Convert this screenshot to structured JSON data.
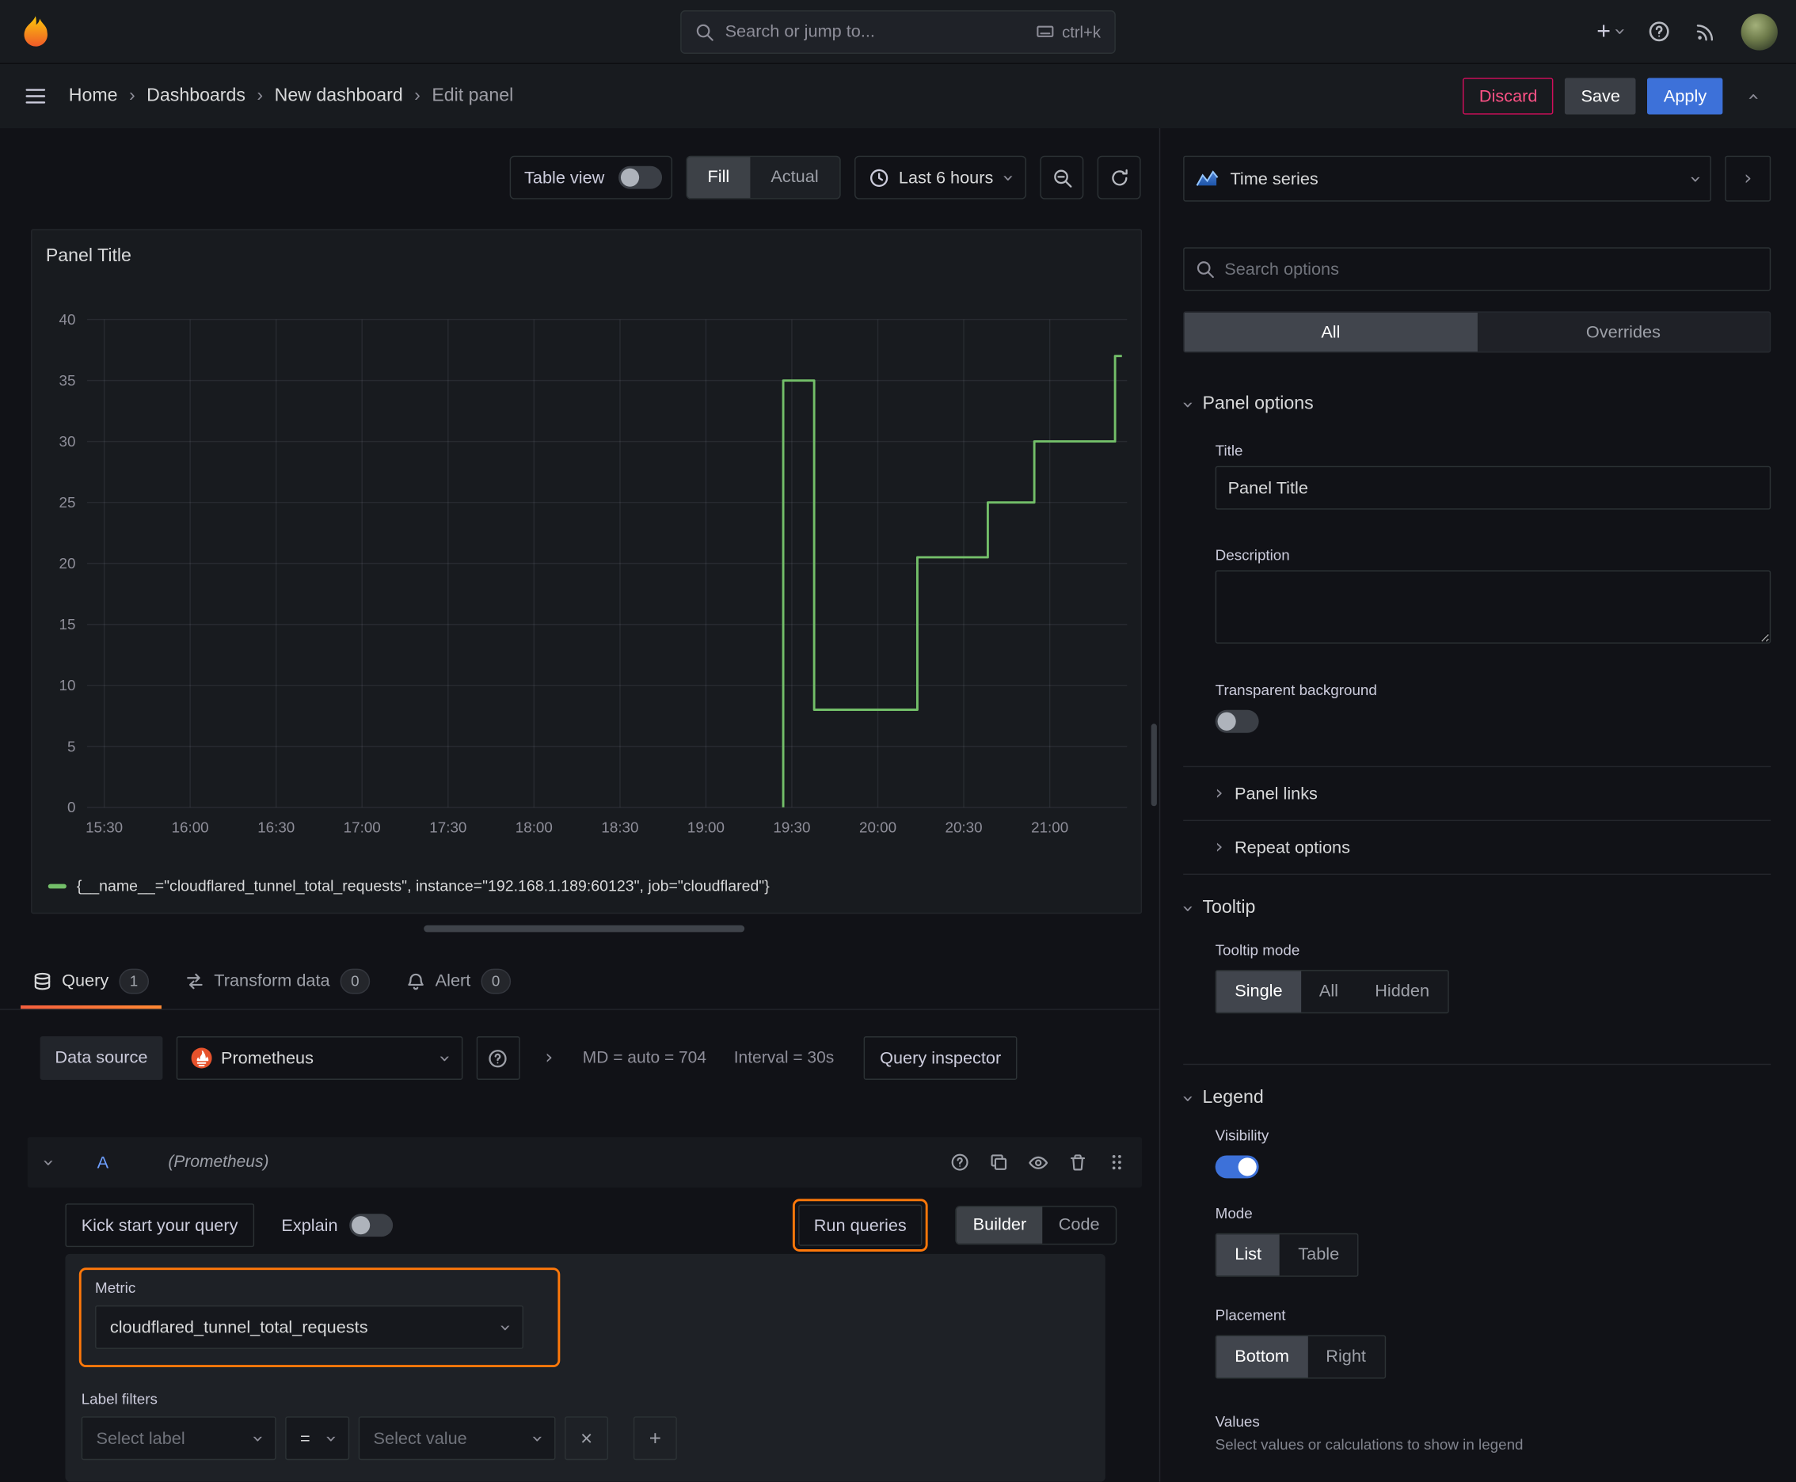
{
  "topnav": {
    "search_placeholder": "Search or jump to...",
    "search_shortcut": "ctrl+k"
  },
  "breadcrumb": {
    "items": [
      "Home",
      "Dashboards",
      "New dashboard",
      "Edit panel"
    ]
  },
  "actions": {
    "discard": "Discard",
    "save": "Save",
    "apply": "Apply"
  },
  "toolbar": {
    "table_view": "Table view",
    "fill": "Fill",
    "actual": "Actual",
    "time_range": "Last 6 hours"
  },
  "panel": {
    "title": "Panel Title"
  },
  "chart_data": {
    "type": "line",
    "title": "Panel Title",
    "x_ticks": [
      "15:30",
      "16:00",
      "16:30",
      "17:00",
      "17:30",
      "18:00",
      "18:30",
      "19:00",
      "19:30",
      "20:00",
      "20:30",
      "21:00"
    ],
    "y_ticks": [
      0,
      5,
      10,
      15,
      20,
      25,
      30,
      35,
      40
    ],
    "ylim": [
      0,
      40
    ],
    "xlim_hours": [
      15.4,
      21.45
    ],
    "grid": true,
    "legend_position": "bottom",
    "series": [
      {
        "name": "{__name__=\"cloudflared_tunnel_total_requests\", instance=\"192.168.1.189:60123\", job=\"cloudflared\"}",
        "color": "#73bf69",
        "points_hours_value": [
          [
            19.45,
            0
          ],
          [
            19.45,
            35
          ],
          [
            19.63,
            35
          ],
          [
            19.63,
            8
          ],
          [
            20.23,
            8
          ],
          [
            20.23,
            20.5
          ],
          [
            20.64,
            20.5
          ],
          [
            20.64,
            25
          ],
          [
            20.91,
            25
          ],
          [
            20.91,
            30
          ],
          [
            21.38,
            30
          ],
          [
            21.38,
            37
          ],
          [
            21.42,
            37
          ]
        ]
      }
    ]
  },
  "tabs": [
    {
      "label": "Query",
      "count": "1"
    },
    {
      "label": "Transform data",
      "count": "0"
    },
    {
      "label": "Alert",
      "count": "0"
    }
  ],
  "query": {
    "datasource_label": "Data source",
    "datasource": "Prometheus",
    "max_data_points": "MD = auto = 704",
    "interval": "Interval = 30s",
    "query_inspector": "Query inspector",
    "ref_id": "A",
    "ref_datasource": "(Prometheus)",
    "kick_start": "Kick start your query",
    "explain": "Explain",
    "run_queries": "Run queries",
    "builder": "Builder",
    "code": "Code",
    "metric_label": "Metric",
    "metric_value": "cloudflared_tunnel_total_requests",
    "label_filters": "Label filters",
    "select_label_placeholder": "Select label",
    "operator": "=",
    "select_value_placeholder": "Select value"
  },
  "options": {
    "visualization": "Time series",
    "search_placeholder": "Search options",
    "tab_all": "All",
    "tab_overrides": "Overrides",
    "panel_options": {
      "heading": "Panel options",
      "title_label": "Title",
      "title_value": "Panel Title",
      "description_label": "Description",
      "transparent_label": "Transparent background",
      "panel_links": "Panel links",
      "repeat_options": "Repeat options"
    },
    "tooltip": {
      "heading": "Tooltip",
      "mode_label": "Tooltip mode",
      "modes": [
        "Single",
        "All",
        "Hidden"
      ],
      "selected_mode": "Single"
    },
    "legend": {
      "heading": "Legend",
      "visibility_label": "Visibility",
      "visibility_on": true,
      "mode_label": "Mode",
      "modes": [
        "List",
        "Table"
      ],
      "selected_mode": "List",
      "placement_label": "Placement",
      "placements": [
        "Bottom",
        "Right"
      ],
      "selected_placement": "Bottom",
      "values_label": "Values",
      "values_description": "Select values or calculations to show in legend"
    }
  },
  "colors": {
    "canvas": "#111217",
    "surface": "#181b1f",
    "border": "#2c3235",
    "primary_blue": "#3d71d9",
    "danger_red": "#ff5286",
    "highlight_orange": "#ff780a",
    "series_green": "#73bf69"
  }
}
